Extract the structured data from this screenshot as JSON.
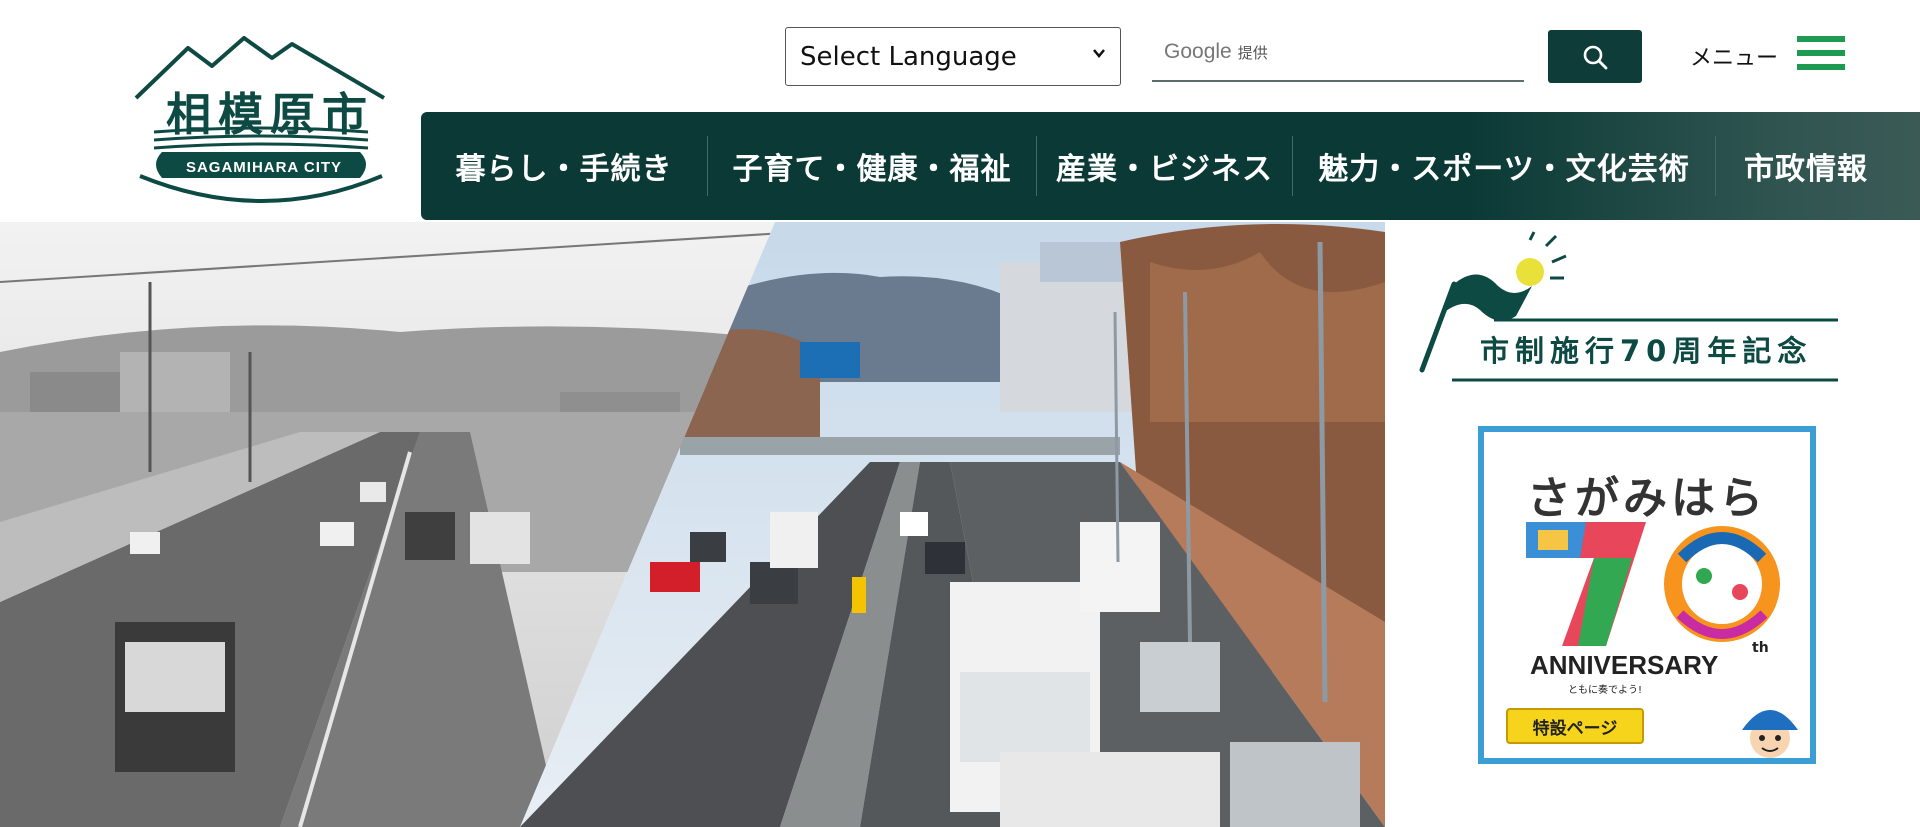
{
  "logo": {
    "name_ja": "相模原市",
    "name_en": "SAGAMIHARA CITY"
  },
  "language_select": {
    "selected": "Select Language"
  },
  "search": {
    "brand": "Google",
    "brand_suffix": "提供",
    "placeholder": ""
  },
  "menu": {
    "label": "メニュー"
  },
  "global_nav": {
    "items": [
      {
        "label": "暮らし・手続き"
      },
      {
        "label": "子育て・健康・福祉"
      },
      {
        "label": "産業・ビジネス"
      },
      {
        "label": "魅力・スポーツ・文化芸術"
      },
      {
        "label": "市政情報"
      }
    ]
  },
  "anniversary": {
    "title": "市制施行70周年記念"
  },
  "banner": {
    "title": "さがみはら",
    "anniversary_text": "ANNIVERSARY",
    "ordinal_suffix": "th",
    "tagline": "ともに奏でよう!",
    "button_label": "特設ページ"
  },
  "colors": {
    "brand_dark": "#0b3a36",
    "brand_green": "#1e9a52",
    "banner_border": "#3b9fd6",
    "banner_button": "#f6d41c"
  },
  "icons": {
    "search": "search-icon",
    "menu": "hamburger-icon",
    "select": "chevron-down-icon"
  }
}
